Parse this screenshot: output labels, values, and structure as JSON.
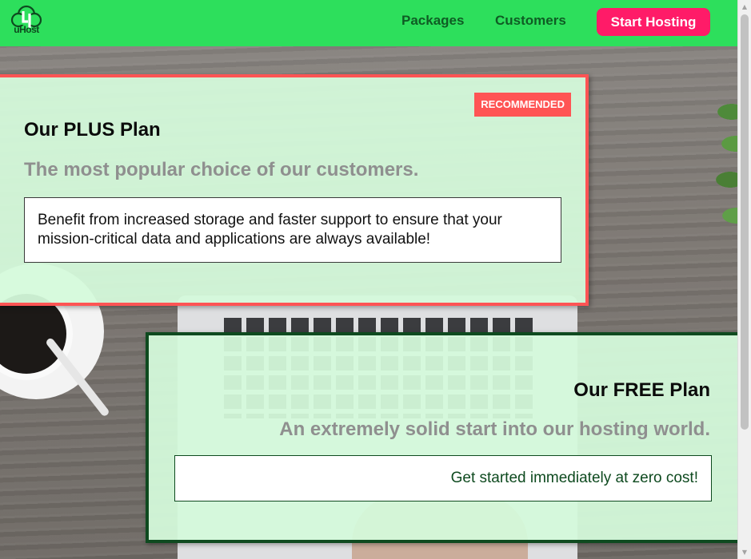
{
  "brand": {
    "logo_text": "uHost",
    "icon": "cloud-tree-logo-icon"
  },
  "nav": {
    "items": [
      {
        "label": "Packages"
      },
      {
        "label": "Customers"
      }
    ],
    "cta_label": "Start Hosting"
  },
  "plans": {
    "plus": {
      "badge": "RECOMMENDED",
      "title": "Our PLUS Plan",
      "subtitle": "The most popular choice of our customers.",
      "description": "Benefit from increased storage and faster support to ensure that your mission-critical data and applications are always available!"
    },
    "free": {
      "title": "Our FREE Plan",
      "subtitle": "An extremely solid start into our hosting world.",
      "description": "Get started immediately at zero cost!"
    }
  },
  "scrollbar": {
    "up_icon": "scroll-up-arrow-icon",
    "down_icon": "scroll-down-arrow-icon"
  },
  "colors": {
    "header": "#2ddf5c",
    "cta": "#ff1b68",
    "plus_accent": "#ff5454",
    "free_accent": "#0e4a1f",
    "card_bg": "#d5fadb"
  }
}
